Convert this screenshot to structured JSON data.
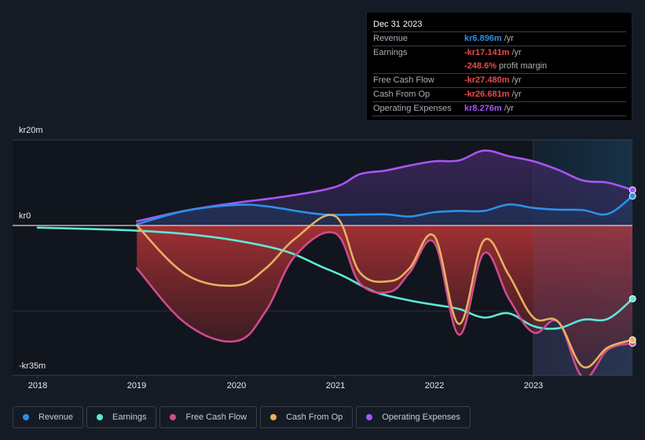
{
  "tooltip": {
    "date": "Dec 31 2023",
    "rows": [
      {
        "label": "Revenue",
        "value": "kr6.896m",
        "unit": "/yr",
        "color": "#2e8fe8"
      },
      {
        "label": "Earnings",
        "value": "-kr17.141m",
        "unit": "/yr",
        "color": "#e84a4a"
      },
      {
        "label": "",
        "value": "-248.6%",
        "unit": "profit margin",
        "color": "#e84a4a"
      },
      {
        "label": "Free Cash Flow",
        "value": "-kr27.480m",
        "unit": "/yr",
        "color": "#e84a4a"
      },
      {
        "label": "Cash From Op",
        "value": "-kr26.681m",
        "unit": "/yr",
        "color": "#e84a4a"
      },
      {
        "label": "Operating Expenses",
        "value": "kr8.276m",
        "unit": "/yr",
        "color": "#a855f7"
      }
    ]
  },
  "legend": [
    {
      "label": "Revenue",
      "color": "#2e8fe8"
    },
    {
      "label": "Earnings",
      "color": "#5ee8d6"
    },
    {
      "label": "Free Cash Flow",
      "color": "#d04a8e"
    },
    {
      "label": "Cash From Op",
      "color": "#e8b060"
    },
    {
      "label": "Operating Expenses",
      "color": "#a855f7"
    }
  ],
  "chart_data": {
    "type": "line",
    "title": "",
    "xlabel": "",
    "ylabel": "",
    "y_tick_labels": [
      "kr20m",
      "kr0",
      "-kr35m"
    ],
    "y_ticks": [
      20,
      0,
      -35
    ],
    "x_tick_labels": [
      "2018",
      "2019",
      "2020",
      "2021",
      "2022",
      "2023"
    ],
    "x_ticks": [
      2018,
      2019,
      2020,
      2021,
      2022,
      2023
    ],
    "xlim": [
      2018,
      2024
    ],
    "ylim": [
      -35,
      20
    ],
    "highlight_start": 2023,
    "series": [
      {
        "name": "Revenue",
        "color": "#2e8fe8",
        "x": [
          2019.0,
          2019.5,
          2020.0,
          2020.3,
          2020.75,
          2021.0,
          2021.5,
          2021.75,
          2022.0,
          2022.25,
          2022.5,
          2022.75,
          2023.0,
          2023.25,
          2023.5,
          2023.75,
          2024.0
        ],
        "y": [
          0.3,
          3.5,
          4.8,
          4.5,
          2.9,
          2.5,
          2.6,
          2.1,
          3.1,
          3.4,
          3.4,
          4.9,
          4.1,
          3.7,
          3.6,
          2.7,
          6.9
        ]
      },
      {
        "name": "Earnings",
        "color": "#5ee8d6",
        "x": [
          2018.0,
          2018.5,
          2019.0,
          2019.5,
          2020.0,
          2020.5,
          2020.85,
          2021.1,
          2021.4,
          2021.75,
          2022.0,
          2022.25,
          2022.5,
          2022.75,
          2023.0,
          2023.25,
          2023.5,
          2023.75,
          2024.0
        ],
        "y": [
          -0.5,
          -0.8,
          -1.2,
          -2.0,
          -3.5,
          -6.0,
          -9.5,
          -12.0,
          -15.5,
          -17.5,
          -18.5,
          -19.5,
          -21.5,
          -20.5,
          -23.5,
          -24.0,
          -22.0,
          -21.8,
          -17.1
        ]
      },
      {
        "name": "Free Cash Flow",
        "color": "#d04a8e",
        "x": [
          2019.0,
          2019.5,
          2020.0,
          2020.3,
          2020.6,
          2021.0,
          2021.25,
          2021.55,
          2021.75,
          2022.0,
          2022.25,
          2022.5,
          2022.75,
          2023.0,
          2023.25,
          2023.5,
          2023.75,
          2024.0
        ],
        "y": [
          -10.0,
          -23.0,
          -27.0,
          -20.0,
          -7.0,
          -1.8,
          -13.5,
          -15.5,
          -11.0,
          -4.0,
          -25.5,
          -6.5,
          -17.0,
          -25.0,
          -22.5,
          -35.5,
          -29.0,
          -27.5
        ]
      },
      {
        "name": "Cash From Op",
        "color": "#e8b060",
        "x": [
          2019.0,
          2019.5,
          2020.0,
          2020.3,
          2020.6,
          2021.0,
          2021.25,
          2021.55,
          2021.75,
          2022.0,
          2022.25,
          2022.5,
          2022.75,
          2023.0,
          2023.25,
          2023.5,
          2023.75,
          2024.0
        ],
        "y": [
          0.0,
          -11.5,
          -14.0,
          -10.0,
          -3.0,
          2.2,
          -11.0,
          -13.0,
          -10.0,
          -2.5,
          -23.0,
          -3.5,
          -11.5,
          -21.5,
          -22.5,
          -33.0,
          -28.5,
          -26.7
        ]
      },
      {
        "name": "Operating Expenses",
        "color": "#a855f7",
        "x": [
          2019.0,
          2019.5,
          2020.0,
          2020.5,
          2021.0,
          2021.25,
          2021.5,
          2021.75,
          2022.0,
          2022.25,
          2022.5,
          2022.75,
          2023.0,
          2023.25,
          2023.5,
          2023.75,
          2024.0
        ],
        "y": [
          1.0,
          3.5,
          5.3,
          6.8,
          9.0,
          12.0,
          12.8,
          14.0,
          15.0,
          15.2,
          17.5,
          16.2,
          15.0,
          13.0,
          10.5,
          10.0,
          8.3
        ]
      }
    ]
  }
}
